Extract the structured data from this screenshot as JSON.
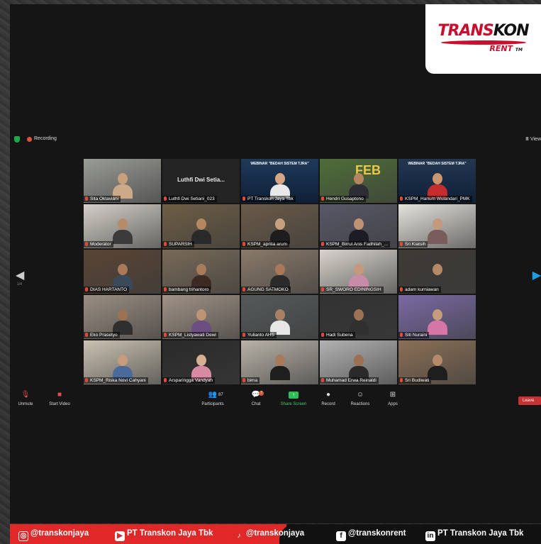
{
  "logo": {
    "line1": "TRANS",
    "line2": "KON",
    "sub": "RENT",
    "tm": "TM"
  },
  "topbar": {
    "recording": "Recording",
    "view": "View"
  },
  "participants": [
    {
      "name": "Sita Oktaviani",
      "bg": "#9a9c96",
      "skin": "#caa07a",
      "cloth": "#ccaa88",
      "type": "photo"
    },
    {
      "name": "Luthfi Dwi Setiani_023",
      "big": "Luthfi Dwi Setia...",
      "type": "text"
    },
    {
      "name": "PT Transkon Jaya Tbk",
      "bg": "#1e3a5a",
      "skin": "#d5a584",
      "cloth": "#e8e8e8",
      "type": "webinar",
      "banner": "WEBINAR \"BEDAH SISTEM TJRA\""
    },
    {
      "name": "Hendri Gusaptono",
      "bg": "#4e6e38",
      "skin": "#b48660",
      "cloth": "#2d2d35",
      "type": "photo",
      "overlay": "FEB"
    },
    {
      "name": "KSPM_Hanum Wulandari_PMK",
      "bg": "#243752",
      "skin": "#c99670",
      "cloth": "#c42d2d",
      "type": "webinar",
      "banner": "WEBINAR \"BEDAH SISTEM TJRA\"",
      "highlight": true
    },
    {
      "name": "Moderator",
      "bg": "#d4d0c8",
      "skin": "#b78a6a",
      "cloth": "#3b3b3b",
      "type": "photo"
    },
    {
      "name": "SUPARSIH",
      "bg": "#6e5e45",
      "skin": "#b48662",
      "cloth": "#2a2a2a",
      "type": "photo"
    },
    {
      "name": "KSPM_aprilia arum",
      "bg": "#6a5a48",
      "skin": "#c7a080",
      "cloth": "#1d1d1d",
      "type": "photo"
    },
    {
      "name": "KSPM_Birrul Anis Fadhilah_...",
      "bg": "#585868",
      "skin": "#bf9274",
      "cloth": "#1c1c24",
      "type": "photo"
    },
    {
      "name": "Sri Kiatsih",
      "bg": "#e5e2dc",
      "skin": "#c39b7c",
      "cloth": "#7a5c5c",
      "type": "photo"
    },
    {
      "name": "DIAS HARTANTO",
      "bg": "#5a4434",
      "skin": "#a87a5a",
      "cloth": "#3a4a5a",
      "type": "photo"
    },
    {
      "name": "bambang trihantoro",
      "bg": "#786a58",
      "skin": "#a87c5a",
      "cloth": "#3d2a22",
      "type": "photo"
    },
    {
      "name": "AGUNG SATMOKO",
      "bg": "#8a7a6a",
      "skin": "#a87858",
      "cloth": "#2a2a2a",
      "type": "photo"
    },
    {
      "name": "SR_SWORO EDININGSIH",
      "bg": "#d8d4cc",
      "skin": "#c49a7a",
      "cloth": "#c98ca8",
      "type": "photo"
    },
    {
      "name": "adam kurniawan",
      "bg": "#3e3a34",
      "skin": "#b68a66",
      "cloth": "#3a3a3a",
      "type": "photo"
    },
    {
      "name": "Eko Prasetyo",
      "bg": "#9a8e82",
      "skin": "#9c7254",
      "cloth": "#2f2f2f",
      "type": "photo"
    },
    {
      "name": "KSPM_Listyawati Dewi",
      "bg": "#a09286",
      "skin": "#bd9474",
      "cloth": "#6c4e82",
      "type": "photo"
    },
    {
      "name": "Yulianto AHS",
      "bg": "#545a5a",
      "skin": "#a88064",
      "cloth": "#e6e6e6",
      "type": "photo"
    },
    {
      "name": "Hadi Subena",
      "bg": "#323232",
      "skin": "#9a7254",
      "cloth": "#303030",
      "type": "photo"
    },
    {
      "name": "Siti Nuraini",
      "bg": "#7a6aa4",
      "skin": "#c49c7c",
      "cloth": "#d676a6",
      "type": "photo"
    },
    {
      "name": "KSPM_Riska Novi Cahyani",
      "bg": "#cac2b2",
      "skin": "#c79c7c",
      "cloth": "#4a6a9a",
      "type": "photo"
    },
    {
      "name": "Arsparingga Vandyah",
      "bg": "#2a2a2a",
      "skin": "#d6b090",
      "cloth": "#d88aa2",
      "type": "photo"
    },
    {
      "name": "bima",
      "bg": "#b8b2a8",
      "skin": "#a87a5a",
      "cloth": "#1e1e1e",
      "type": "photo"
    },
    {
      "name": "Muhamad Erwa Reinaldi",
      "bg": "#b2b2b2",
      "skin": "#9c7050",
      "cloth": "#2a2a2a",
      "type": "photo"
    },
    {
      "name": "Sri Budiwati",
      "bg": "#8a7056",
      "skin": "#b48a6a",
      "cloth": "#1e1e1e",
      "type": "photo"
    }
  ],
  "page_indicator": "1/4",
  "controls": {
    "unmute": "Unmute",
    "start_video": "Start Video",
    "participants": "Participants",
    "participants_count": "87",
    "chat": "Chat",
    "chat_badge": "7",
    "share": "Share Screen",
    "record": "Record",
    "reactions": "Reactions",
    "apps": "Apps",
    "leave": "Leave"
  },
  "social": [
    {
      "icon": "instagram-icon",
      "glyph": "◎",
      "text": "@transkonjaya"
    },
    {
      "icon": "youtube-icon",
      "glyph": "▶",
      "text": "PT Transkon Jaya Tbk"
    },
    {
      "icon": "tiktok-icon",
      "glyph": "♪",
      "text": "@transkonjaya"
    },
    {
      "icon": "facebook-icon",
      "glyph": "f",
      "text": "@transkonrent"
    },
    {
      "icon": "linkedin-icon",
      "glyph": "in",
      "text": "PT Transkon Jaya Tbk"
    }
  ]
}
